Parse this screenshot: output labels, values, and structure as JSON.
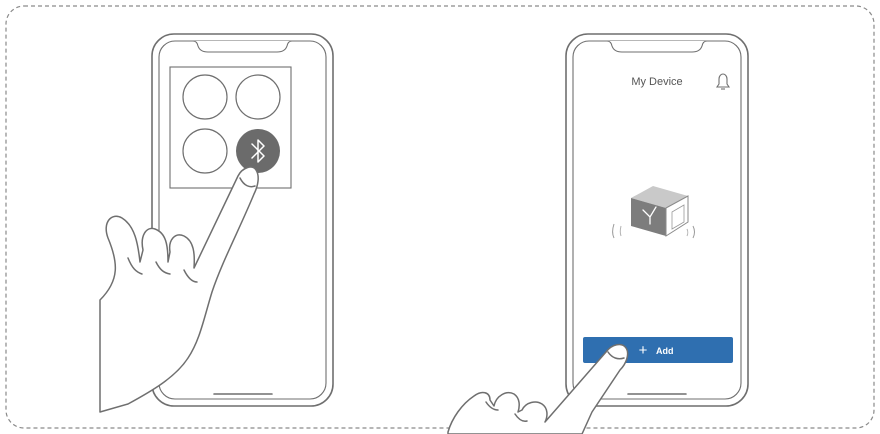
{
  "app_screen": {
    "title": "My Device",
    "add_label": "Add",
    "add_plus": "+"
  },
  "icons": {
    "left_panel": "bluetooth-icon",
    "bell": "bell-icon",
    "device": "device-cube-icon"
  },
  "colors": {
    "border": "#8a8a8a",
    "phone_stroke": "#6f6f6f",
    "bluetooth_fill": "#6b6b6b",
    "add_button": "#2f6fb0",
    "add_text": "#ffffff",
    "title_text": "#555555"
  }
}
